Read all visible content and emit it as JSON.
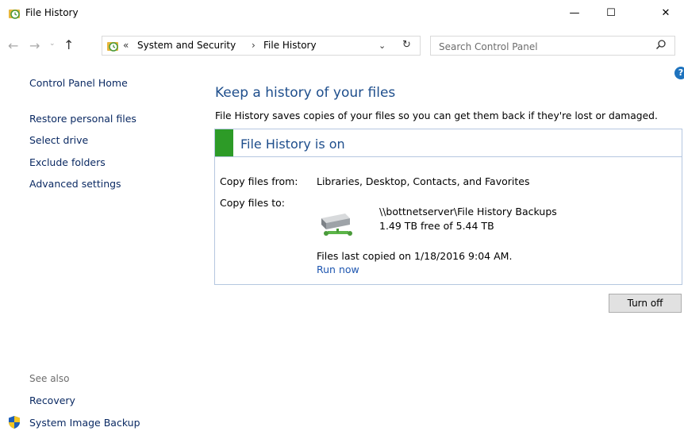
{
  "window": {
    "title": "File History",
    "minimize": "—",
    "maximize": "☐",
    "close": "✕"
  },
  "nav": {
    "back": "←",
    "forward": "→",
    "recent": "⌄",
    "up": "↑",
    "path_separator_start": "«",
    "path": [
      "System and Security",
      "File History"
    ],
    "path_separator": "›",
    "dropdown": "⌄",
    "refresh": "↻",
    "search_placeholder": "Search Control Panel",
    "help": "?"
  },
  "sidebar": {
    "home": "Control Panel Home",
    "links": [
      "Restore personal files",
      "Select drive",
      "Exclude folders",
      "Advanced settings"
    ],
    "see_also_label": "See also",
    "see_also": [
      "Recovery",
      "System Image Backup"
    ]
  },
  "main": {
    "heading": "Keep a history of your files",
    "description": "File History saves copies of your files so you can get them back if they're lost or damaged.",
    "status_title": "File History is on",
    "status_color": "#2d9b27",
    "copy_from_label": "Copy files from:",
    "copy_from_value": "Libraries, Desktop, Contacts, and Favorites",
    "copy_to_label": "Copy files to:",
    "drive_path": "\\\\bottnetserver\\File History Backups",
    "drive_free": "1.49 TB free of 5.44 TB",
    "last_copied": "Files last copied on 1/18/2016 9:04 AM.",
    "run_now": "Run now",
    "turn_off": "Turn off"
  },
  "icons": {
    "app": "file-history-icon",
    "address": "file-history-icon",
    "search": "search-icon",
    "drive": "network-drive-icon",
    "shield": "shield-icon"
  }
}
